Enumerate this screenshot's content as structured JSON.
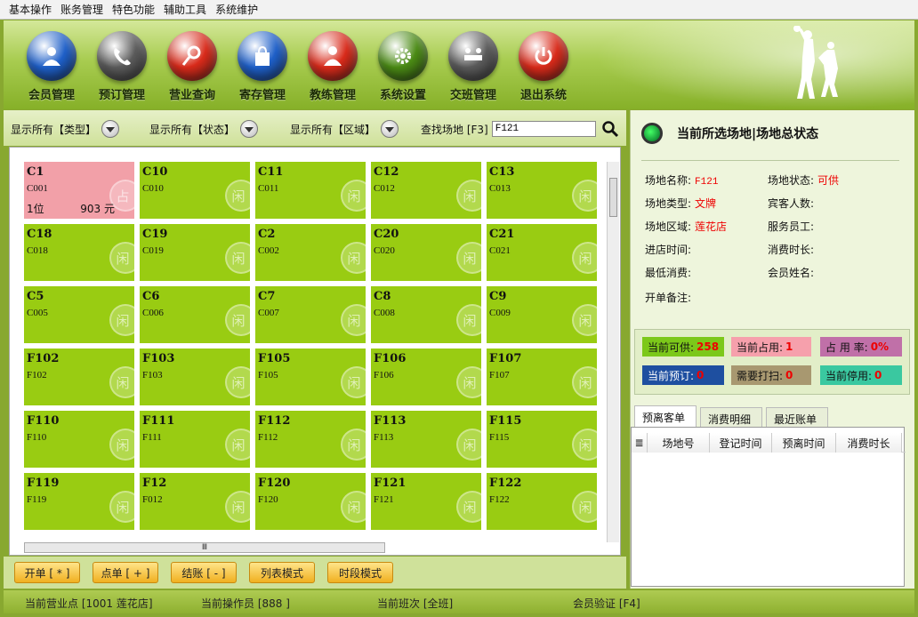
{
  "menu": [
    "基本操作",
    "账务管理",
    "特色功能",
    "辅助工具",
    "系统维护"
  ],
  "toolbar": [
    {
      "label": "会员管理",
      "icon": "member-icon",
      "color": "#1e5fc8"
    },
    {
      "label": "预订管理",
      "icon": "phone-icon",
      "color": "#5a5a5a"
    },
    {
      "label": "营业查询",
      "icon": "search-icon",
      "color": "#d82a1a"
    },
    {
      "label": "寄存管理",
      "icon": "bag-icon",
      "color": "#1e5fc8"
    },
    {
      "label": "教练管理",
      "icon": "coach-icon",
      "color": "#d82a1a"
    },
    {
      "label": "系统设置",
      "icon": "gear-icon",
      "color": "#4a8a14"
    },
    {
      "label": "交班管理",
      "icon": "handover-icon",
      "color": "#5a5a5a"
    },
    {
      "label": "退出系统",
      "icon": "power-icon",
      "color": "#d82a1a"
    }
  ],
  "filters": {
    "type": "显示所有【类型】",
    "status": "显示所有【状态】",
    "area": "显示所有【区域】",
    "search_label": "查找场地 [F3]",
    "search_value": "F121"
  },
  "venues": [
    [
      {
        "name": "C1",
        "code": "C001",
        "selected": true,
        "seats": "1位",
        "amount": "903 元"
      },
      {
        "name": "C10",
        "code": "C010"
      },
      {
        "name": "C11",
        "code": "C011"
      },
      {
        "name": "C12",
        "code": "C012"
      },
      {
        "name": "C13",
        "code": "C013"
      }
    ],
    [
      {
        "name": "C18",
        "code": "C018"
      },
      {
        "name": "C19",
        "code": "C019"
      },
      {
        "name": "C2",
        "code": "C002"
      },
      {
        "name": "C20",
        "code": "C020"
      },
      {
        "name": "C21",
        "code": "C021"
      }
    ],
    [
      {
        "name": "C5",
        "code": "C005"
      },
      {
        "name": "C6",
        "code": "C006"
      },
      {
        "name": "C7",
        "code": "C007"
      },
      {
        "name": "C8",
        "code": "C008"
      },
      {
        "name": "C9",
        "code": "C009"
      }
    ],
    [
      {
        "name": "F102",
        "code": "F102"
      },
      {
        "name": "F103",
        "code": "F103"
      },
      {
        "name": "F105",
        "code": "F105"
      },
      {
        "name": "F106",
        "code": "F106"
      },
      {
        "name": "F107",
        "code": "F107"
      }
    ],
    [
      {
        "name": "F110",
        "code": "F110"
      },
      {
        "name": "F111",
        "code": "F111"
      },
      {
        "name": "F112",
        "code": "F112"
      },
      {
        "name": "F113",
        "code": "F113"
      },
      {
        "name": "F115",
        "code": "F115"
      }
    ],
    [
      {
        "name": "F119",
        "code": "F119"
      },
      {
        "name": "F12",
        "code": "F012"
      },
      {
        "name": "F120",
        "code": "F120"
      },
      {
        "name": "F121",
        "code": "F121"
      },
      {
        "name": "F122",
        "code": "F122"
      }
    ]
  ],
  "tile_watermark": "闲",
  "selected_badge": "占",
  "hscroll_grip": "Ⅲ",
  "actions": [
    "开单 [ * ]",
    "点单 [ + ]",
    "结账 [ - ]",
    "列表模式",
    "时段模式"
  ],
  "panel": {
    "title": "当前所选场地|场地总状态",
    "fields": {
      "name_label": "场地名称:",
      "name_value": "F121",
      "state_label": "场地状态:",
      "state_value": "可供",
      "type_label": "场地类型:",
      "type_value": "文牌",
      "guests_label": "宾客人数:",
      "area_label": "场地区域:",
      "area_value": "莲花店",
      "staff_label": "服务员工:",
      "entry_label": "进店时间:",
      "duration_label": "消费时长:",
      "min_label": "最低消费:",
      "member_label": "会员姓名:",
      "note_label": "开单备注:"
    },
    "stats": {
      "available_label": "当前可供:",
      "available_value": "258",
      "occupied_label": "当前占用:",
      "occupied_value": "1",
      "rate_label": "占 用 率:",
      "rate_value": "0%",
      "reserved_label": "当前预订:",
      "reserved_value": "0",
      "clean_label": "需要打扫:",
      "clean_value": "0",
      "stopped_label": "当前停用:",
      "stopped_value": "0"
    },
    "tabs": [
      "预离客单",
      "消费明细",
      "最近账单"
    ],
    "columns": [
      "场地号",
      "登记时间",
      "预离时间",
      "消费时长"
    ]
  },
  "status": {
    "store": "当前营业点 [1001 莲花店]",
    "operator": "当前操作员 [888 ]",
    "shift": "当前班次 [全班]",
    "member": "会员验证 [F4]"
  }
}
